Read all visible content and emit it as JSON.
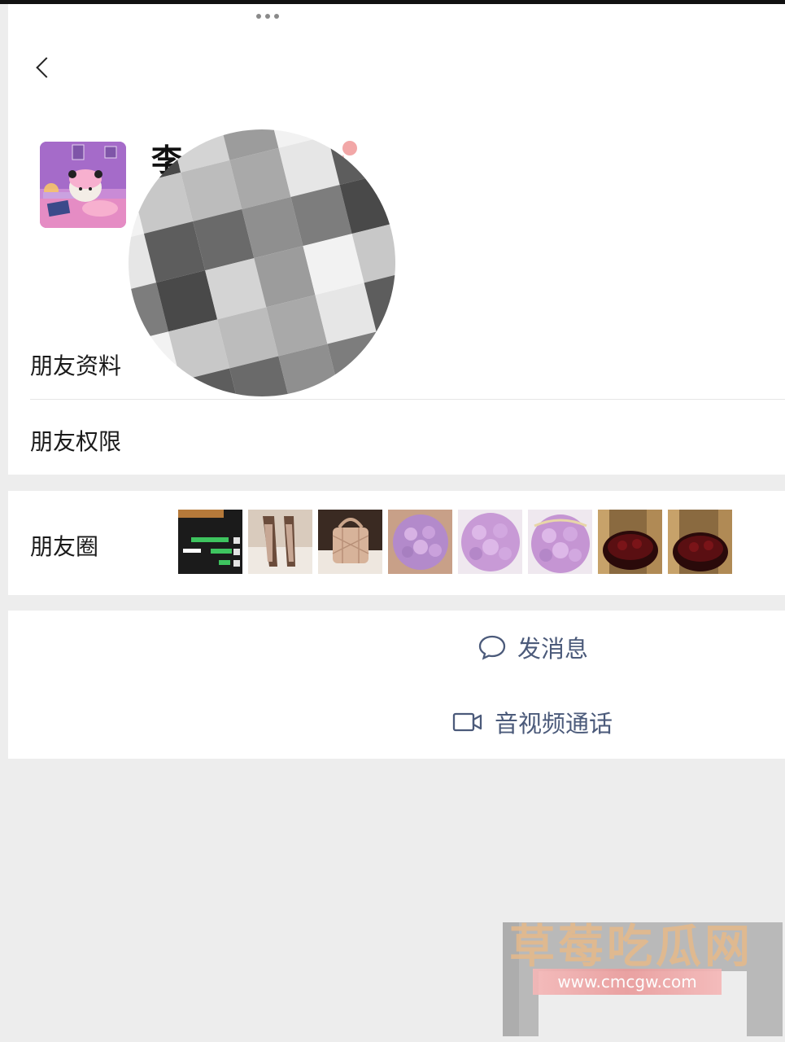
{
  "header": {
    "back_icon": "chevron-left-icon",
    "more_icon": "more-dots-icon"
  },
  "profile": {
    "name_visible": "李",
    "avatar": "cartoon-avatar",
    "gender_icon": "female-icon"
  },
  "rows": {
    "friend_info": "朋友资料",
    "friend_permissions": "朋友权限",
    "moments": "朋友圈"
  },
  "moments_thumbnails": [
    "chat-screenshot",
    "high-heel-shoes",
    "handbag",
    "purple-flower-bouquet",
    "purple-flower-bouquet",
    "purple-flower-bouquet",
    "red-rose-bouquet",
    "red-rose-bouquet"
  ],
  "actions": {
    "send_message": "发消息",
    "video_call": "音视频通话"
  },
  "watermark": {
    "title": "草莓吃瓜网",
    "url": "www.cmcgw.com"
  },
  "colors": {
    "action_text": "#4b5a7a",
    "background": "#ededed"
  }
}
